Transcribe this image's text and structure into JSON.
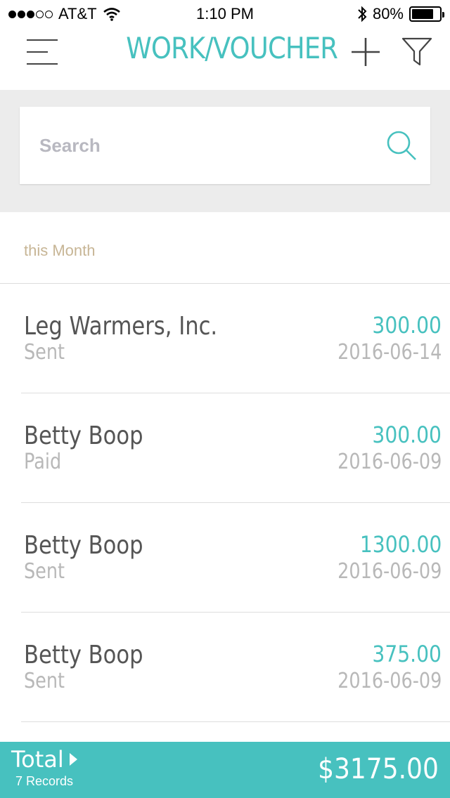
{
  "status_bar": {
    "carrier": "AT&T",
    "time": "1:10 PM",
    "battery_percent": "80%",
    "battery_level": 0.8,
    "signal_bars_filled": 3,
    "signal_bars_total": 5
  },
  "header": {
    "title": "WORK/VOUCHER",
    "menu_icon": "hamburger-menu-icon",
    "add_icon": "plus-icon",
    "filter_icon": "funnel-filter-icon"
  },
  "search": {
    "placeholder": "Search",
    "value": "",
    "icon": "magnifier-icon"
  },
  "section": {
    "label": "this Month"
  },
  "vouchers": [
    {
      "name": "Leg Warmers, Inc.",
      "status": "Sent",
      "amount": "300.00",
      "date": "2016-06-14"
    },
    {
      "name": "Betty Boop",
      "status": "Paid",
      "amount": "300.00",
      "date": "2016-06-09"
    },
    {
      "name": "Betty Boop",
      "status": "Sent",
      "amount": "1300.00",
      "date": "2016-06-09"
    },
    {
      "name": "Betty Boop",
      "status": "Sent",
      "amount": "375.00",
      "date": "2016-06-09"
    }
  ],
  "footer": {
    "total_label": "Total",
    "record_count": "7 Records",
    "total_amount": "$3175.00"
  },
  "colors": {
    "accent": "#47c1bf",
    "section_label": "#c7b595",
    "search_background": "#ececec"
  }
}
